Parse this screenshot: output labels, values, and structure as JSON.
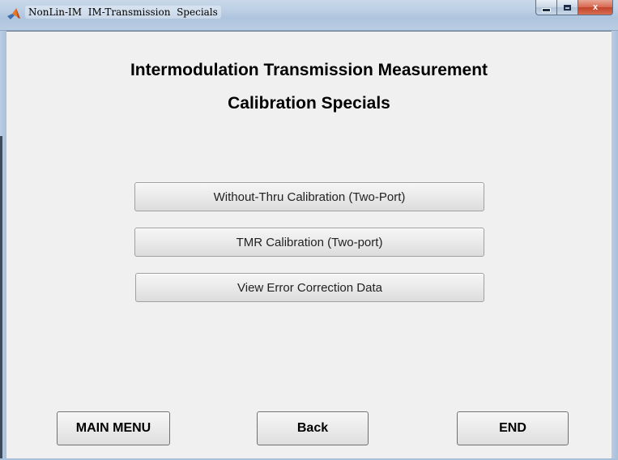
{
  "window": {
    "title": "NonLin-IM  IM-Transmission  Specials",
    "app_icon": "matlab-icon",
    "controls": [
      "minimize-icon",
      "maximize-icon",
      "close-icon"
    ],
    "close_glyph": "x"
  },
  "header": {
    "line1": "Intermodulation Transmission Measurement",
    "line2": "Calibration Specials"
  },
  "actions": {
    "without_thru": "Without-Thru Calibration (Two-Port)",
    "tmr": "TMR Calibration (Two-port)",
    "view_error": "View Error Correction Data"
  },
  "footer": {
    "main_menu": "MAIN MENU",
    "back": "Back",
    "end": "END"
  },
  "colors": {
    "background": "#f0f0f0",
    "titlebar": "#bccfe4",
    "close_button": "#c3432a"
  }
}
